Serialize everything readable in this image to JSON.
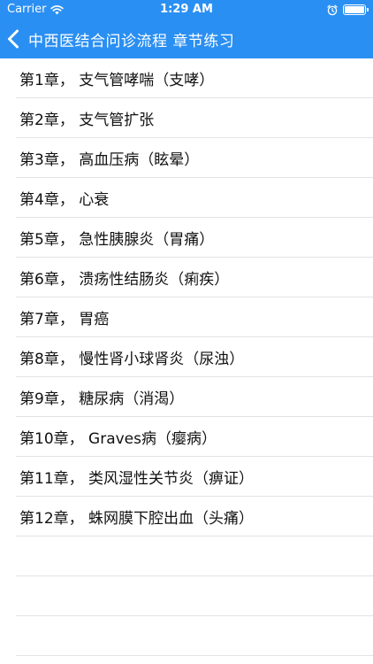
{
  "status_bar": {
    "carrier": "Carrier",
    "time": "1:29 AM"
  },
  "nav": {
    "back_icon": "chevron-left-icon",
    "title": "中西医结合问诊流程 章节练习"
  },
  "colors": {
    "nav_background": "#2a8ff2",
    "nav_text": "#ffffff",
    "row_text": "#111111",
    "separator": "#e3e3e3"
  },
  "chapters": [
    {
      "label": "第1章，  支气管哮喘（支哮）"
    },
    {
      "label": "第2章，  支气管扩张"
    },
    {
      "label": "第3章，  高血压病（眩晕）"
    },
    {
      "label": "第4章，  心衰"
    },
    {
      "label": "第5章，  急性胰腺炎（胃痛）"
    },
    {
      "label": "第6章，  溃疡性结肠炎（痢疾）"
    },
    {
      "label": "第7章，  胃癌"
    },
    {
      "label": "第8章，  慢性肾小球肾炎（尿浊）"
    },
    {
      "label": "第9章，  糖尿病（消渴）"
    },
    {
      "label": "第10章，  Graves病（瘿病）"
    },
    {
      "label": "第11章，  类风湿性关节炎（痹证）"
    },
    {
      "label": "第12章，  蛛网膜下腔出血（头痛）"
    }
  ]
}
